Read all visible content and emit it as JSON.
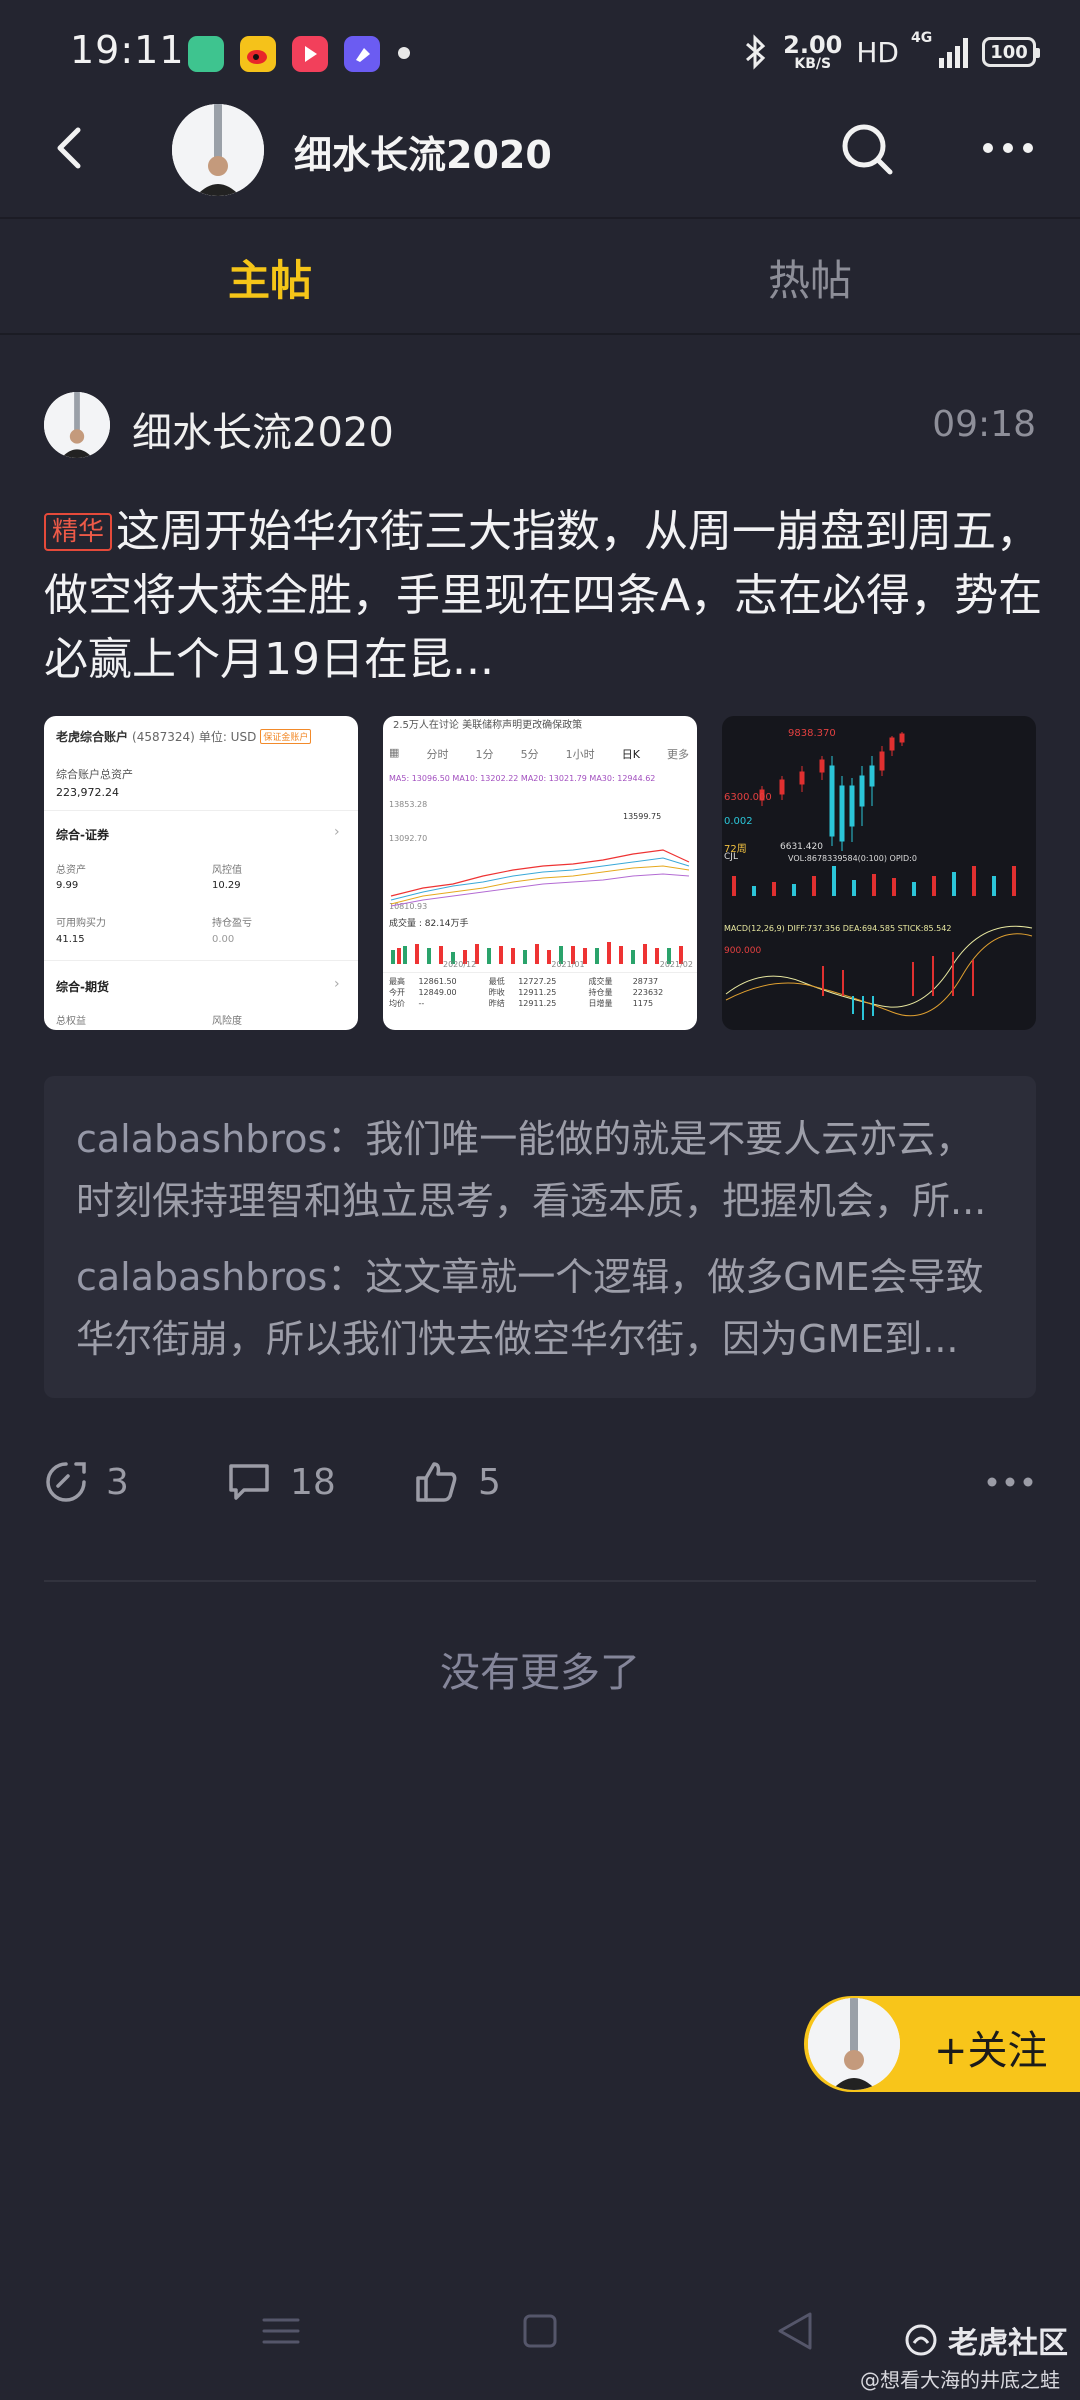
{
  "status_bar": {
    "time": "19:11",
    "net_speed": "2.00",
    "net_unit": "KB/S",
    "hd": "HD",
    "network": "4G",
    "battery": "100"
  },
  "header": {
    "title": "细水长流2020"
  },
  "tabs": [
    {
      "label": "主帖",
      "active": true
    },
    {
      "label": "热帖",
      "active": false
    }
  ],
  "post": {
    "author": "细水长流2020",
    "time": "09:18",
    "badge": "精华",
    "text": "这周开始华尔街三大指数，从周一崩盘到周五，做空将大获全胜，手里现在四条A，志在必得，势在必赢上个月19日在昆..."
  },
  "thumb1": {
    "title": "老虎综合账户",
    "account": "(4587324)",
    "unit": "单位: USD",
    "tag": "保证金账户",
    "total_label": "综合账户总资产",
    "total_value": "223,972.24",
    "sec_label": "综合-证券",
    "asset_label": "总资产",
    "asset_value": "9.99",
    "risk_label": "风控值",
    "risk_value": "10.29",
    "buy_label": "可用购买力",
    "buy_value": "41.15",
    "pnl_label": "持仓盈亏",
    "pnl_value": "0.00",
    "fut_label": "综合-期货",
    "equity_label": "总权益",
    "degree_label": "风险度"
  },
  "thumb2": {
    "top_text": "2.5万人在讨论 美联储称声明更改确保政策",
    "tabs": [
      "分时",
      "1分",
      "5分",
      "1小时",
      "日K",
      "更多"
    ],
    "ma": "MA5: 13096.50  MA10: 13202.22  MA20: 13021.79  MA30: 12944.62",
    "y1": "13853.28",
    "y2": "13092.70",
    "y3": "10810.93",
    "peak": "13599.75",
    "vol": "成交量 : 82.14万手",
    "dates": [
      "2020/12",
      "2021/01",
      "2021/02"
    ],
    "rows": [
      [
        "最高",
        "12861.50",
        "最低",
        "12727.25",
        "成交量",
        "28737"
      ],
      [
        "今开",
        "12849.00",
        "昨收",
        "12911.25",
        "持仓量",
        "223632"
      ],
      [
        "均价",
        "--",
        "昨结",
        "12911.25",
        "日增量",
        "1175"
      ]
    ]
  },
  "thumb3": {
    "high": "9838.370",
    "left1": "6300.000",
    "left2": "0.002",
    "period": "72周",
    "cjl": "CJL",
    "low": "6631.420",
    "vol": "VOL:8678339584(0:100)  OPID:0",
    "macd": "MACD(12,26,9)  DIFF:737.356  DEA:694.585  STICK:85.542",
    "axis": "900.000"
  },
  "comments": [
    {
      "user": "calabashbros",
      "text": "：我们唯一能做的就是不要人云亦云，时刻保持理智和独立思考，看透本质，把握机会，所..."
    },
    {
      "user": "calabashbros",
      "text": "：这文章就一个逻辑，做多GME会导致华尔街崩，所以我们快去做空华尔街，因为GME到..."
    }
  ],
  "actions": {
    "shares": "3",
    "comments": "18",
    "likes": "5"
  },
  "footer": {
    "no_more": "没有更多了"
  },
  "follow": {
    "label": "+关注"
  },
  "watermark": {
    "brand": "老虎社区",
    "sub": "@想看大海的井底之蛙"
  },
  "colors": {
    "background": "#242530",
    "accent_yellow": "#f5c518",
    "badge_red": "#e54a3a"
  }
}
